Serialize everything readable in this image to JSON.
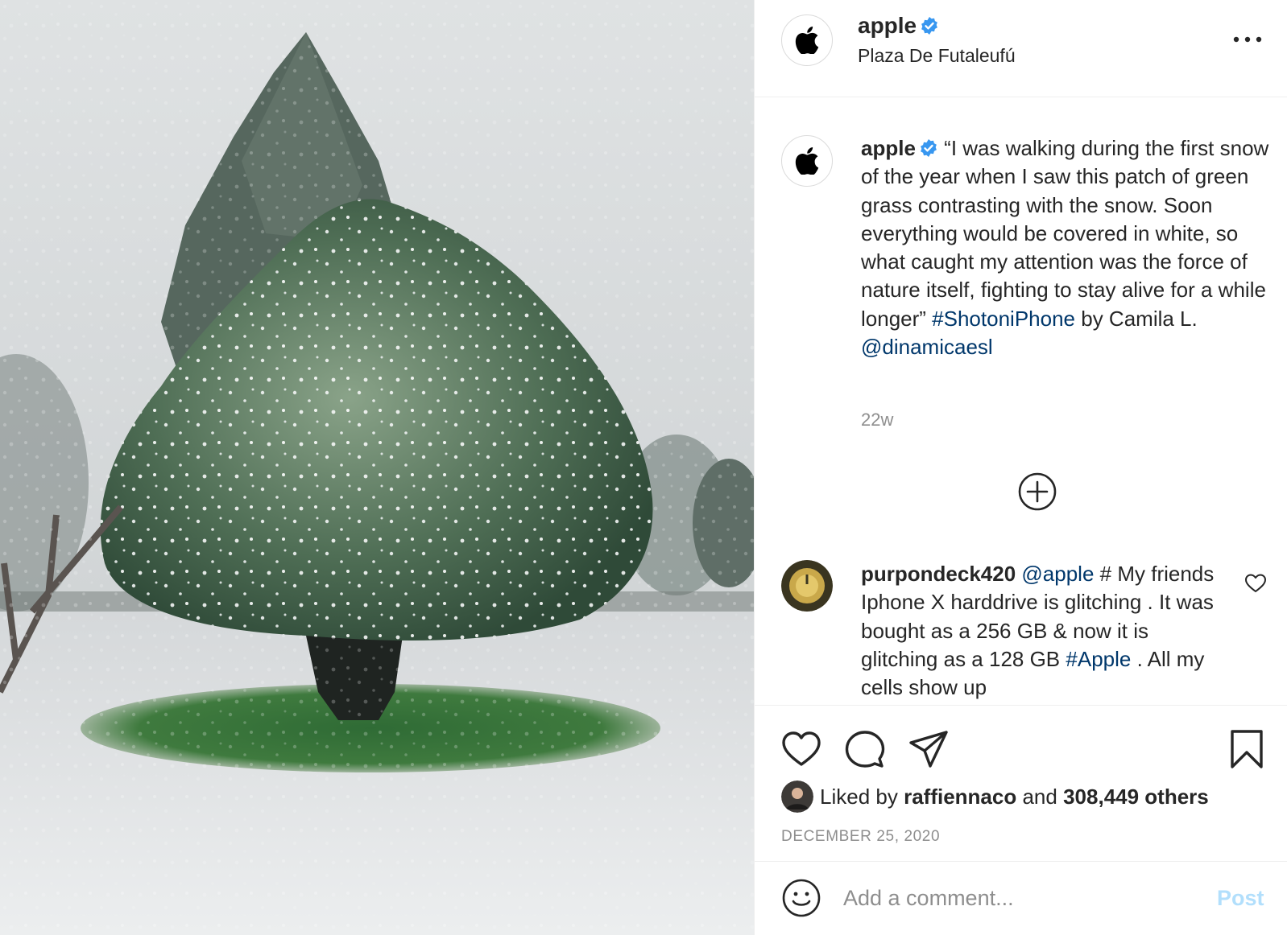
{
  "post": {
    "author": "apple",
    "verified": true,
    "location": "Plaza De Futaleufú"
  },
  "caption": {
    "username": "apple",
    "text": "“I was walking during the first snow of the year when I saw this patch of green grass contrasting with the snow. Soon everything would be covered in white, so what caught my attention was the force of nature itself, fighting to stay alive for a while longer”",
    "hashtag": "#ShotoniPhone",
    "credit": "by Camila L.",
    "mention": "@dinamicaesl",
    "time": "22w"
  },
  "comment": {
    "username": "purpondeck420",
    "mention": "@apple",
    "text": "# My friends Iphone X harddrive is glitching . It was bought as a 256 GB & now it is glitching as a 128 GB",
    "hashtag": "#Apple",
    "text_after": ". All my cells show up"
  },
  "likes": {
    "prefix": "Liked by",
    "liker": "raffiennaco",
    "middle": "and",
    "others": "308,449 others"
  },
  "date": "DECEMBER 25, 2020",
  "comment_box": {
    "placeholder": "Add a comment...",
    "post_label": "Post"
  },
  "colors": {
    "text": "#262626",
    "secondary": "#8e8e8e",
    "link": "#00376b",
    "verified": "#3897f0",
    "post_disabled": "#b2dffc",
    "border": "#efefef"
  },
  "icons": [
    "apple-logo-icon",
    "verified-badge-icon",
    "more-options-icon",
    "add-circle-icon",
    "heart-icon",
    "comment-bubble-icon",
    "paper-plane-icon",
    "bookmark-icon",
    "emoji-icon"
  ]
}
